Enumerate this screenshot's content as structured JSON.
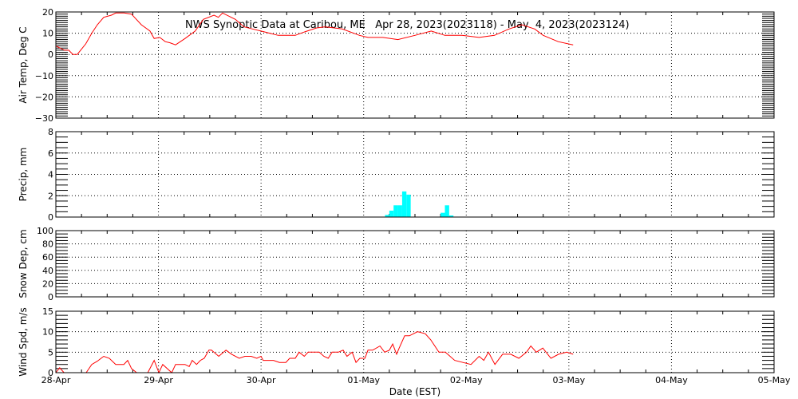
{
  "chart_data": {
    "type": "line",
    "title": "NWS Synoptic Data at Caribou, ME   Apr 28, 2023(2023118) - May  4, 2023(2023124)",
    "xlabel": "Date (EST)",
    "x_units": "hours since 28-Apr 00:00 EST",
    "x_ticks": [
      "28-Apr",
      "29-Apr",
      "30-Apr",
      "01-May",
      "02-May",
      "03-May",
      "04-May",
      "05-May"
    ],
    "xlim": [
      0,
      168
    ],
    "grid": true,
    "colors": {
      "line": "#ff0000",
      "bar": "#00ffff",
      "axis": "#000000"
    },
    "panels": [
      {
        "name": "air-temp",
        "ylabel": "Air Temp, Deg C",
        "ylim": [
          -30,
          20
        ],
        "y_ticks": [
          -30,
          -20,
          -10,
          0,
          10,
          20
        ],
        "y_tick_labels": [
          "−30",
          "−20",
          "−10",
          "0",
          "10",
          "20"
        ],
        "kind": "line",
        "x": [
          0,
          2,
          3,
          4,
          5,
          7,
          8.4,
          9.7,
          11.2,
          13,
          14,
          16,
          17.7,
          20,
          22,
          23,
          24.3,
          25.6,
          26.7,
          28,
          30.2,
          32.6,
          34.5,
          37,
          38,
          39,
          42,
          44,
          46,
          48,
          50,
          52,
          56,
          58,
          61,
          63,
          67,
          71,
          73,
          76.5,
          80,
          84,
          87.8,
          91,
          95,
          99,
          102.6,
          106,
          109,
          112,
          114,
          117.5,
          121
        ],
        "y": [
          4,
          2,
          2,
          0,
          0,
          5,
          10,
          14,
          17.5,
          18.5,
          19.5,
          19.5,
          19,
          14,
          11,
          7.5,
          8,
          6,
          5.5,
          4.5,
          7.5,
          11,
          16.5,
          18.5,
          17.5,
          19.5,
          16.5,
          13,
          12,
          11,
          10,
          9,
          9,
          10.5,
          12.5,
          13,
          12,
          9,
          8,
          8,
          7,
          9,
          11,
          9,
          9,
          8,
          9,
          12,
          14,
          12,
          9,
          6,
          4.5
        ]
      },
      {
        "name": "precip",
        "ylabel": "Precip, mm",
        "ylim": [
          0,
          8
        ],
        "y_ticks": [
          0,
          2,
          4,
          6,
          8
        ],
        "y_tick_labels": [
          "0",
          "2",
          "4",
          "6",
          "8"
        ],
        "kind": "bar",
        "x": [
          77,
          78,
          79,
          80,
          81,
          82,
          90,
          91,
          92
        ],
        "y": [
          0.2,
          0.6,
          1.1,
          1.1,
          2.4,
          2.1,
          0.4,
          1.1,
          0.15
        ]
      },
      {
        "name": "snow-depth",
        "ylabel": "Snow Dep, cm",
        "ylim": [
          0,
          100
        ],
        "y_ticks": [
          0,
          20,
          40,
          60,
          80,
          100
        ],
        "y_tick_labels": [
          "0",
          "20",
          "40",
          "60",
          "80",
          "100"
        ],
        "kind": "line",
        "x": [],
        "y": []
      },
      {
        "name": "wind-speed",
        "ylabel": "Wind Spd, m/s",
        "ylim": [
          0,
          15
        ],
        "y_ticks": [
          0,
          5,
          10,
          15
        ],
        "y_tick_labels": [
          "0",
          "5",
          "10",
          "15"
        ],
        "kind": "line",
        "x": [
          0,
          0.9,
          1.9,
          null,
          7.1,
          8.4,
          9.7,
          11.2,
          12.5,
          14,
          15.9,
          16.8,
          17.7,
          18.9,
          null,
          21.5,
          23,
          24.1,
          25,
          27.1,
          28,
          30.2,
          31.2,
          31.9,
          32.9,
          33.8,
          34.7,
          35.8,
          36.4,
          38.1,
          39.8,
          41.1,
          42.9,
          44.2,
          45.7,
          47,
          48,
          48.5,
          50.9,
          52.3,
          53.8,
          54.7,
          56,
          56.9,
          58.1,
          59,
          61.6,
          62.7,
          63.7,
          64.6,
          66.1,
          67.2,
          68.1,
          69.3,
          70.2,
          71.1,
          72.3,
          73,
          74.1,
          75.8,
          76.9,
          78,
          78.8,
          79.7,
          80.3,
          81.6,
          82.7,
          84.6,
          86.4,
          87.7,
          89.6,
          91.1,
          93.3,
          95.2,
          97.1,
          99,
          100.1,
          101.2,
          102.7,
          104.5,
          106.4,
          108.3,
          110.1,
          111.1,
          112.4,
          113.9,
          115.8,
          117.6,
          119.5,
          121
        ],
        "y": [
          0,
          1.2,
          0,
          null,
          0,
          2,
          2.8,
          4,
          3.5,
          2,
          2,
          3,
          1,
          0,
          null,
          0,
          3,
          0,
          2,
          0,
          2,
          2,
          1.5,
          3,
          2,
          3,
          3.5,
          5.5,
          5.5,
          4,
          5.5,
          4.5,
          3.5,
          4,
          4,
          3.5,
          4,
          3,
          3,
          2.5,
          2.5,
          3.5,
          3.5,
          5,
          4,
          5,
          5,
          4,
          3.5,
          5,
          5,
          5.5,
          4,
          5,
          2.5,
          3.5,
          3.5,
          5.5,
          5.5,
          6.5,
          5,
          5.5,
          7,
          4.5,
          6,
          9,
          9,
          10,
          9.5,
          8,
          5,
          5,
          3,
          2.5,
          2,
          4,
          3,
          5,
          2,
          4.5,
          4.5,
          3.5,
          5,
          6.5,
          5,
          6,
          3.5,
          4.5,
          5,
          4.5
        ]
      }
    ]
  }
}
